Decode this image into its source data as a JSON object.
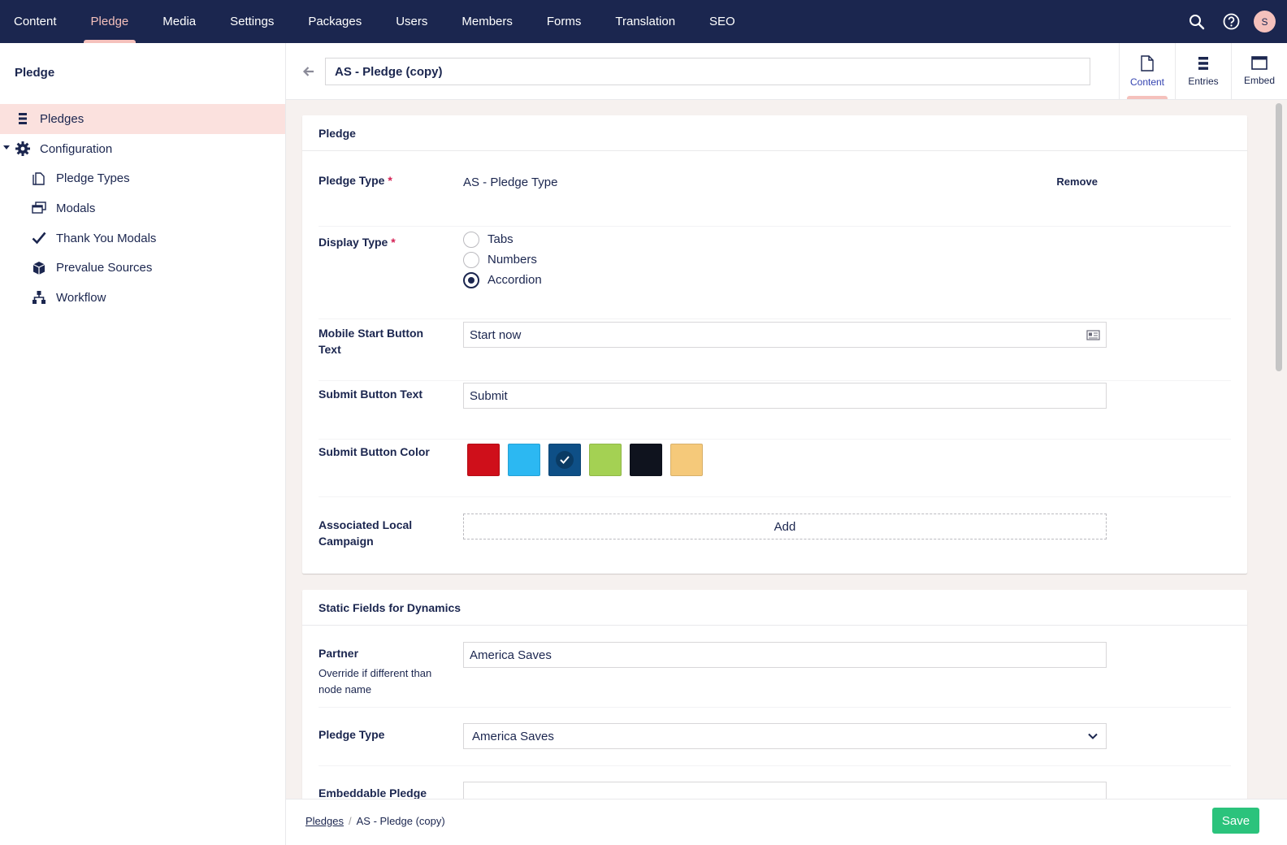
{
  "topnav": {
    "items": [
      {
        "label": "Content"
      },
      {
        "label": "Pledge",
        "active": true
      },
      {
        "label": "Media"
      },
      {
        "label": "Settings"
      },
      {
        "label": "Packages"
      },
      {
        "label": "Users"
      },
      {
        "label": "Members"
      },
      {
        "label": "Forms"
      },
      {
        "label": "Translation"
      },
      {
        "label": "SEO"
      }
    ],
    "tools": {
      "search_icon": "search-icon",
      "help_icon": "help-icon",
      "avatar_initial": "S"
    }
  },
  "sidebar": {
    "title": "Pledge",
    "items": [
      {
        "label": "Pledges",
        "icon": "list-icon",
        "active": true
      },
      {
        "label": "Configuration",
        "icon": "gear-icon",
        "expanded": true
      },
      {
        "label": "Pledge Types",
        "icon": "documents-icon"
      },
      {
        "label": "Modals",
        "icon": "windows-icon"
      },
      {
        "label": "Thank You Modals",
        "icon": "check-icon"
      },
      {
        "label": "Prevalue Sources",
        "icon": "box-icon"
      },
      {
        "label": "Workflow",
        "icon": "workflow-icon"
      }
    ]
  },
  "editor": {
    "name": "AS - Pledge (copy)",
    "apps": [
      {
        "label": "Content",
        "icon": "document-icon",
        "active": true
      },
      {
        "label": "Entries",
        "icon": "list-icon"
      },
      {
        "label": "Embed",
        "icon": "window-icon"
      }
    ]
  },
  "pledge_group": {
    "title": "Pledge",
    "pledge_type": {
      "label": "Pledge Type",
      "required": "*",
      "value": "AS - Pledge Type",
      "remove": "Remove"
    },
    "display_type": {
      "label": "Display Type",
      "required": "*",
      "options": [
        {
          "label": "Tabs",
          "checked": false
        },
        {
          "label": "Numbers",
          "checked": false
        },
        {
          "label": "Accordion",
          "checked": true
        }
      ]
    },
    "mobile_start": {
      "label": "Mobile Start Button Text",
      "value": "Start now"
    },
    "submit_text": {
      "label": "Submit Button Text",
      "value": "Submit"
    },
    "submit_color": {
      "label": "Submit Button Color",
      "colors": [
        "#cf0f1a",
        "#2cb8f2",
        "#0e4f86",
        "#a4d153",
        "#0f131e",
        "#f5c97a"
      ],
      "selected_index": 2
    },
    "campaign": {
      "label": "Associated Local Campaign",
      "add": "Add"
    }
  },
  "static_group": {
    "title": "Static Fields for Dynamics",
    "partner": {
      "label": "Partner",
      "description": "Override if different than node name",
      "value": "America Saves"
    },
    "pledge_type": {
      "label": "Pledge Type",
      "value": "America Saves"
    },
    "embeddable": {
      "label": "Embeddable Pledge",
      "value": ""
    }
  },
  "footer": {
    "breadcrumb_root": "Pledges",
    "breadcrumb_sep": "/",
    "breadcrumb_current": "AS - Pledge (copy)",
    "save": "Save"
  },
  "colors": {
    "nav_bg": "#1b264f",
    "accent": "#f5c1bc",
    "save": "#2bc37c"
  }
}
